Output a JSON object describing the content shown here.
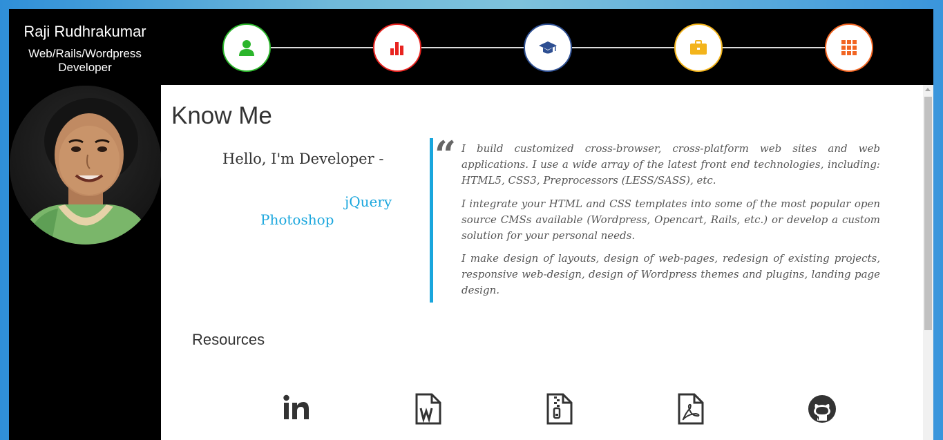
{
  "profile": {
    "name": "Raji Rudhrakumar",
    "role": "Web/Rails/Wordpress Developer"
  },
  "nav": [
    {
      "icon": "user-icon",
      "color": "#2bb52b"
    },
    {
      "icon": "bar-chart-icon",
      "color": "#e8231f"
    },
    {
      "icon": "graduation-cap-icon",
      "color": "#2e4f92"
    },
    {
      "icon": "briefcase-icon",
      "color": "#f3b41b"
    },
    {
      "icon": "grid-icon",
      "color": "#f26522"
    }
  ],
  "main": {
    "title": "Know Me",
    "hello": "Hello, I'm Developer -",
    "skills": [
      "jQuery",
      "Photoshop"
    ],
    "quote_mark": "“",
    "paragraphs": [
      "I build customized cross-browser, cross-platform web sites and web applications. I use a wide array of the latest front end technologies, including: HTML5, CSS3, Preprocessors (LESS/SASS), etc.",
      "I integrate your HTML and CSS templates into some of the most popular open source CMSs available (Wordpress, Opencart, Rails, etc.) or develop a custom solution for your personal needs.",
      "I make design of layouts, design of web-pages, redesign of existing projects, responsive web-design, design of Wordpress themes and plugins, landing page design."
    ]
  },
  "resources": {
    "title": "Resources",
    "items": [
      {
        "icon": "linkedin-icon"
      },
      {
        "icon": "word-document-icon"
      },
      {
        "icon": "zip-file-icon"
      },
      {
        "icon": "pdf-file-icon"
      },
      {
        "icon": "github-icon"
      }
    ]
  },
  "colors": {
    "accent": "#19a6dd",
    "sidebar": "#000000"
  }
}
